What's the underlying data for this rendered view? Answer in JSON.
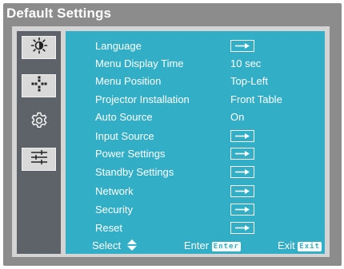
{
  "window": {
    "title": "Default Settings"
  },
  "sidebar": {
    "items": [
      {
        "icon": "brightness-icon"
      },
      {
        "icon": "screen-position-icon"
      },
      {
        "icon": "gear-icon"
      },
      {
        "icon": "sliders-icon"
      }
    ]
  },
  "menu": {
    "rows": [
      {
        "label": "Language",
        "value": "",
        "type": "submenu"
      },
      {
        "label": "Menu Display Time",
        "value": "10 sec",
        "type": "value"
      },
      {
        "label": "Menu Position",
        "value": "Top-Left",
        "type": "value"
      },
      {
        "label": "Projector Installation",
        "value": "Front Table",
        "type": "value"
      },
      {
        "label": "Auto Source",
        "value": "On",
        "type": "value"
      },
      {
        "label": "Input Source",
        "value": "",
        "type": "submenu"
      },
      {
        "label": "Power Settings",
        "value": "",
        "type": "submenu"
      },
      {
        "label": "Standby Settings",
        "value": "",
        "type": "submenu"
      },
      {
        "label": "Network",
        "value": "",
        "type": "submenu"
      },
      {
        "label": "Security",
        "value": "",
        "type": "submenu"
      },
      {
        "label": "Reset",
        "value": "",
        "type": "submenu"
      }
    ]
  },
  "footer": {
    "select_label": "Select",
    "enter_label": "Enter",
    "enter_badge": "Enter",
    "exit_label": "Exit",
    "exit_badge": "Exit"
  },
  "colors": {
    "content_bg": "#32afc7",
    "sidebar_bg": "#5e6369",
    "frame_bg": "#8c8c8c"
  }
}
